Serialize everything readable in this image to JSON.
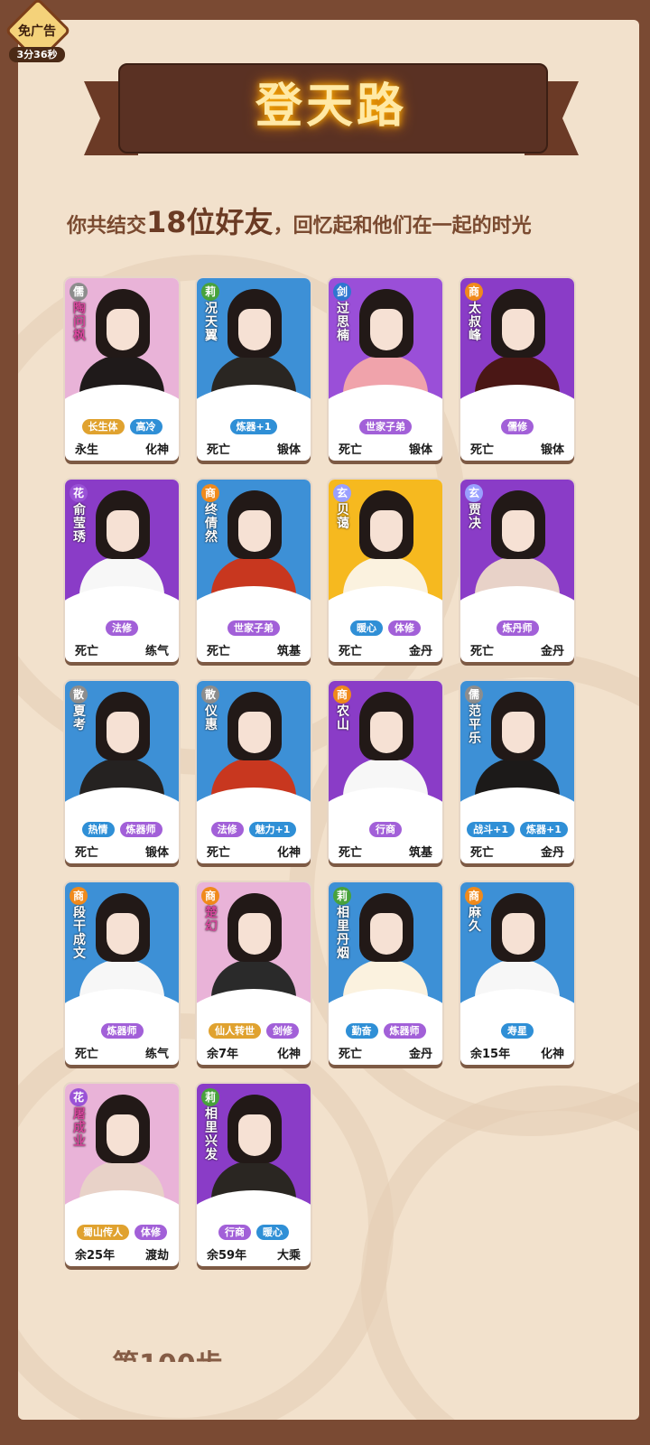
{
  "ad": {
    "label": "免广告",
    "timer": "3分36秒"
  },
  "banner": {
    "title": "登天路"
  },
  "summary": {
    "prefix": "你共结交",
    "count": "18位好友",
    "suffix": "，回忆起和他们在一起的时光"
  },
  "friends": [
    {
      "name": "陶问枫",
      "badge": "儒",
      "badge_color": "#8d8d8d",
      "bg": "#e9b3d8",
      "name_color": "#d6469c",
      "body_color": "#1f1a1a",
      "tags": [
        {
          "text": "长生体",
          "color": "#e0a22f"
        },
        {
          "text": "高冷",
          "color": "#2f8fd6"
        }
      ],
      "status": "永生",
      "realm": "化神"
    },
    {
      "name": "况天翼",
      "badge": "莉",
      "badge_color": "#48a23c",
      "bg": "#3d90d6",
      "name_color": "#ffffff",
      "body_color": "#2a2622",
      "tags": [
        {
          "text": "炼器+1",
          "color": "#2f8fd6"
        }
      ],
      "status": "死亡",
      "realm": "锻体"
    },
    {
      "name": "过思楠",
      "badge": "剑",
      "badge_color": "#2f77d0",
      "bg": "#9a4fd8",
      "name_color": "#ffffff",
      "body_color": "#f0a3ab",
      "tags": [
        {
          "text": "世家子弟",
          "color": "#a260d8"
        }
      ],
      "status": "死亡",
      "realm": "锻体"
    },
    {
      "name": "太叔峰",
      "badge": "商",
      "badge_color": "#f08a1c",
      "bg": "#8a3cc7",
      "name_color": "#ffffff",
      "body_color": "#4a1715",
      "tags": [
        {
          "text": "儒修",
          "color": "#a260d8"
        }
      ],
      "status": "死亡",
      "realm": "锻体"
    },
    {
      "name": "俞莹琇",
      "badge": "花",
      "badge_color": "#9a52d6",
      "bg": "#8a3cc7",
      "name_color": "#ffffff",
      "body_color": "#f7f7f7",
      "tags": [
        {
          "text": "法修",
          "color": "#a260d8"
        }
      ],
      "status": "死亡",
      "realm": "练气"
    },
    {
      "name": "终倩然",
      "badge": "商",
      "badge_color": "#f08a1c",
      "bg": "#3d90d6",
      "name_color": "#ffffff",
      "body_color": "#c8371f",
      "tags": [
        {
          "text": "世家子弟",
          "color": "#a260d8"
        }
      ],
      "status": "死亡",
      "realm": "筑基"
    },
    {
      "name": "贝蔼",
      "badge": "玄",
      "badge_color": "#9aa0ff",
      "bg": "#f6b91f",
      "name_color": "#ffffff",
      "body_color": "#fbf2df",
      "tags": [
        {
          "text": "暖心",
          "color": "#2f8fd6"
        },
        {
          "text": "体修",
          "color": "#a260d8"
        }
      ],
      "status": "死亡",
      "realm": "金丹"
    },
    {
      "name": "贾决",
      "badge": "玄",
      "badge_color": "#9aa0ff",
      "bg": "#8a3cc7",
      "name_color": "#ffffff",
      "body_color": "#e8d2c8",
      "tags": [
        {
          "text": "炼丹师",
          "color": "#a260d8"
        }
      ],
      "status": "死亡",
      "realm": "金丹"
    },
    {
      "name": "夏考",
      "badge": "散",
      "badge_color": "#8d8d8d",
      "bg": "#3d90d6",
      "name_color": "#ffffff",
      "body_color": "#252221",
      "tags": [
        {
          "text": "热情",
          "color": "#2f8fd6"
        },
        {
          "text": "炼器师",
          "color": "#a260d8"
        }
      ],
      "status": "死亡",
      "realm": "锻体"
    },
    {
      "name": "仪惠",
      "badge": "散",
      "badge_color": "#8d8d8d",
      "bg": "#3d90d6",
      "name_color": "#ffffff",
      "body_color": "#c8371f",
      "tags": [
        {
          "text": "法修",
          "color": "#a260d8"
        },
        {
          "text": "魅力+1",
          "color": "#2f8fd6"
        }
      ],
      "status": "死亡",
      "realm": "化神"
    },
    {
      "name": "农山",
      "badge": "商",
      "badge_color": "#f08a1c",
      "bg": "#8a3cc7",
      "name_color": "#ffffff",
      "body_color": "#f7f7f7",
      "tags": [
        {
          "text": "行商",
          "color": "#a260d8"
        }
      ],
      "status": "死亡",
      "realm": "筑基"
    },
    {
      "name": "范平乐",
      "badge": "儒",
      "badge_color": "#8d8d8d",
      "bg": "#3d90d6",
      "name_color": "#ffffff",
      "body_color": "#1c1a19",
      "tags": [
        {
          "text": "战斗+1",
          "color": "#2f8fd6"
        },
        {
          "text": "炼器+1",
          "color": "#2f8fd6"
        }
      ],
      "status": "死亡",
      "realm": "金丹"
    },
    {
      "name": "段干成文",
      "badge": "商",
      "badge_color": "#f08a1c",
      "bg": "#3d90d6",
      "name_color": "#ffffff",
      "body_color": "#f7f7f7",
      "tags": [
        {
          "text": "炼器师",
          "color": "#a260d8"
        }
      ],
      "status": "死亡",
      "realm": "练气"
    },
    {
      "name": "楚幻",
      "badge": "商",
      "badge_color": "#f08a1c",
      "bg": "#e9b3d8",
      "name_color": "#d6469c",
      "body_color": "#2a2a2a",
      "tags": [
        {
          "text": "仙人转世",
          "color": "#e0a22f"
        },
        {
          "text": "剑修",
          "color": "#a260d8"
        }
      ],
      "status": "余7年",
      "realm": "化神"
    },
    {
      "name": "相里丹烟",
      "badge": "莉",
      "badge_color": "#48a23c",
      "bg": "#3d90d6",
      "name_color": "#ffffff",
      "body_color": "#fbf2df",
      "tags": [
        {
          "text": "勤奋",
          "color": "#2f8fd6"
        },
        {
          "text": "炼器师",
          "color": "#a260d8"
        }
      ],
      "status": "死亡",
      "realm": "金丹"
    },
    {
      "name": "麻久",
      "badge": "商",
      "badge_color": "#f08a1c",
      "bg": "#3d90d6",
      "name_color": "#ffffff",
      "body_color": "#f7f7f7",
      "tags": [
        {
          "text": "寿星",
          "color": "#2f8fd6"
        }
      ],
      "status": "余15年",
      "realm": "化神"
    },
    {
      "name": "屠成业",
      "badge": "花",
      "badge_color": "#9a52d6",
      "bg": "#e9b3d8",
      "name_color": "#d6469c",
      "body_color": "#e8d2c8",
      "tags": [
        {
          "text": "蜀山传人",
          "color": "#e0a22f"
        },
        {
          "text": "体修",
          "color": "#a260d8"
        }
      ],
      "status": "余25年",
      "realm": "渡劫"
    },
    {
      "name": "相里兴发",
      "badge": "莉",
      "badge_color": "#48a23c",
      "bg": "#8a3cc7",
      "name_color": "#ffffff",
      "body_color": "#2a2622",
      "tags": [
        {
          "text": "行商",
          "color": "#a260d8"
        },
        {
          "text": "暖心",
          "color": "#2f8fd6"
        }
      ],
      "status": "余59年",
      "realm": "大乘"
    }
  ],
  "footer_partial": "第100步"
}
